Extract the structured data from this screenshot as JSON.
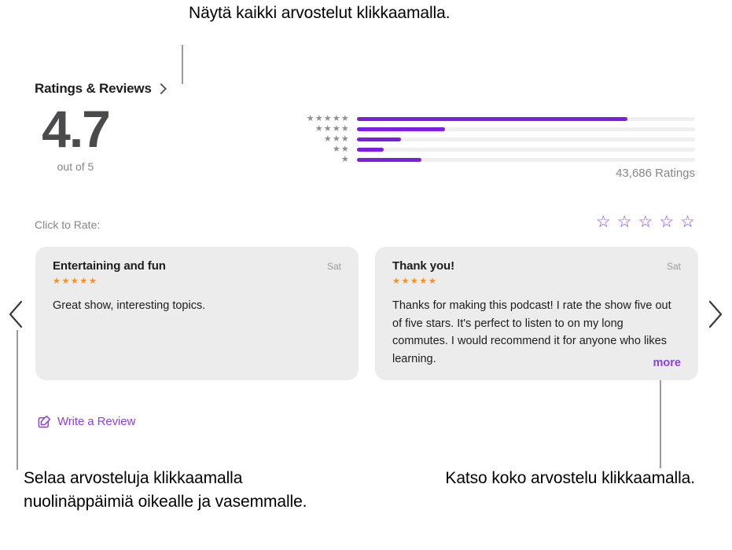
{
  "callouts": {
    "top": "Näytä kaikki arvostelut klikkaamalla.",
    "bottom_left": "Selaa arvosteluja klikkaamalla nuolinäppäimiä oikealle ja vasemmalle.",
    "bottom_right": "Katso koko arvostelu klikkaamalla."
  },
  "section": {
    "title": "Ratings & Reviews",
    "disclosure_icon": "chevron-right-icon"
  },
  "score": {
    "value": "4.7",
    "out_of": "out of 5"
  },
  "histogram": {
    "rows": [
      {
        "stars": "★★★★★",
        "star_count": 5,
        "percent": 80
      },
      {
        "stars": "★★★★",
        "star_count": 4,
        "percent": 26
      },
      {
        "stars": "★★★",
        "star_count": 3,
        "percent": 13
      },
      {
        "stars": "★★",
        "star_count": 2,
        "percent": 8
      },
      {
        "stars": "★",
        "star_count": 1,
        "percent": 19
      }
    ]
  },
  "ratings_count": "43,686 Ratings",
  "rate": {
    "label": "Click to Rate:",
    "stars": [
      "☆",
      "☆",
      "☆",
      "☆",
      "☆"
    ]
  },
  "reviews": [
    {
      "title": "Entertaining and fun",
      "date": "Sat",
      "stars": "★★★★★",
      "body": "Great show, interesting topics.",
      "truncated": false,
      "more_label": ""
    },
    {
      "title": "Thank you!",
      "date": "Sat",
      "stars": "★★★★★",
      "body": "Thanks for making this podcast! I rate the show five out of five stars. It's perfect to listen to on my long commutes. I would recommend it for anyone who likes learning.",
      "truncated": true,
      "more_label": "more"
    }
  ],
  "write_review": {
    "label": "Write a Review",
    "icon": "compose-icon"
  },
  "nav": {
    "prev_icon": "chevron-left-icon",
    "next_icon": "chevron-right-icon"
  },
  "colors": {
    "accent_purple": "#7b1ee0",
    "link_purple": "#8a3ff0",
    "star_orange": "#f7901e",
    "card_gray": "#ececec",
    "track_gray": "#efeff0"
  }
}
